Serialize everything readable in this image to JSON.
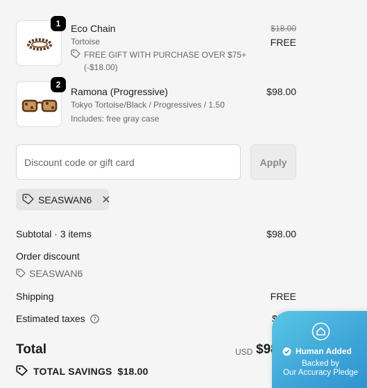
{
  "items": [
    {
      "qty": "1",
      "name": "Eco Chain",
      "variant": "Tortoise",
      "gift_note": "FREE GIFT WITH PURCHASE OVER $75+",
      "gift_amount": "(-$18.00)",
      "original_price": "$18.00",
      "price": "FREE"
    },
    {
      "qty": "2",
      "name": "Ramona (Progressive)",
      "variant": "Tokyo Tortoise/Black / Progressives / 1.50",
      "includes": "Includes: free gray case",
      "price": "$98.00"
    }
  ],
  "discount": {
    "placeholder": "Discount code or gift card",
    "apply_label": "Apply",
    "applied_code": "SEASWAN6"
  },
  "summary": {
    "subtotal_label": "Subtotal · 3 items",
    "subtotal_value": "$98.00",
    "order_discount_label": "Order discount",
    "order_discount_code": "SEASWAN6",
    "shipping_label": "Shipping",
    "shipping_value": "FREE",
    "taxes_label": "Estimated taxes",
    "taxes_value": "$0.98",
    "total_label": "Total",
    "currency": "USD",
    "total_value": "$98.98",
    "savings_label": "TOTAL SAVINGS",
    "savings_value": "$18.00"
  },
  "badge": {
    "title": "Human Added",
    "line1": "Backed by",
    "line2": "Our Accuracy Pledge"
  }
}
